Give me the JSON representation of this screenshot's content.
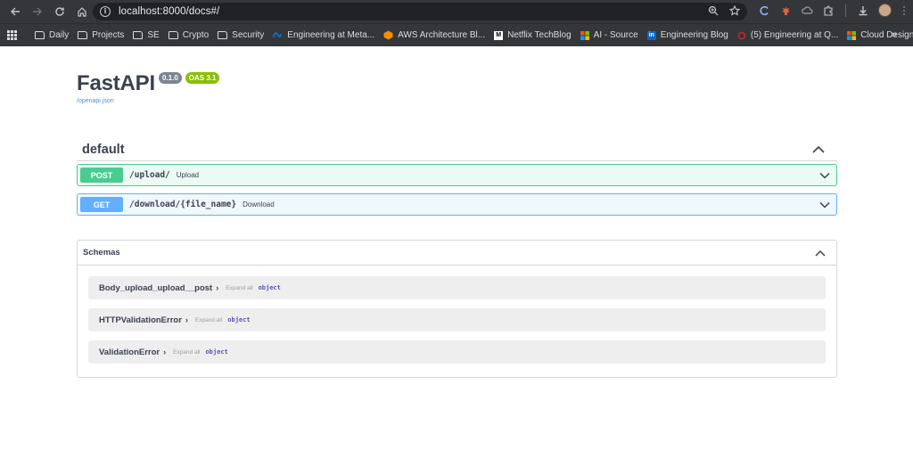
{
  "browser": {
    "url": "localhost:8000/docs#/",
    "bookmarks": [
      {
        "label": "Daily",
        "icon": "folder-icon"
      },
      {
        "label": "Projects",
        "icon": "folder-icon"
      },
      {
        "label": "SE",
        "icon": "folder-icon"
      },
      {
        "label": "Crypto",
        "icon": "folder-icon"
      },
      {
        "label": "Security",
        "icon": "folder-icon"
      },
      {
        "label": "Engineering at Meta...",
        "icon": "meta-icon"
      },
      {
        "label": "AWS Architecture Bl...",
        "icon": "aws-icon"
      },
      {
        "label": "Netflix TechBlog",
        "icon": "medium-icon"
      },
      {
        "label": "AI - Source",
        "icon": "microsoft-icon"
      },
      {
        "label": "Engineering Blog",
        "icon": "linkedin-icon"
      },
      {
        "label": "(5) Engineering at Q...",
        "icon": "quora-icon"
      },
      {
        "label": "Cloud Design Patter...",
        "icon": "microsoft-icon"
      }
    ],
    "more_label": "»"
  },
  "api": {
    "title": "FastAPI",
    "version": "0.1.0",
    "oas": "OAS 3.1",
    "spec_link": "/openapi.json"
  },
  "tag": {
    "name": "default",
    "operations": [
      {
        "method": "POST",
        "path": "/upload/",
        "summary": "Upload"
      },
      {
        "method": "GET",
        "path": "/download/{file_name}",
        "summary": "Download"
      }
    ]
  },
  "schemas": {
    "title": "Schemas",
    "expand_label": "Expand all",
    "type_label": "object",
    "models": [
      "Body_upload_upload__post",
      "HTTPValidationError",
      "ValidationError"
    ]
  },
  "colors": {
    "post": "#49cc90",
    "get": "#61affe",
    "text": "#3b4151"
  }
}
